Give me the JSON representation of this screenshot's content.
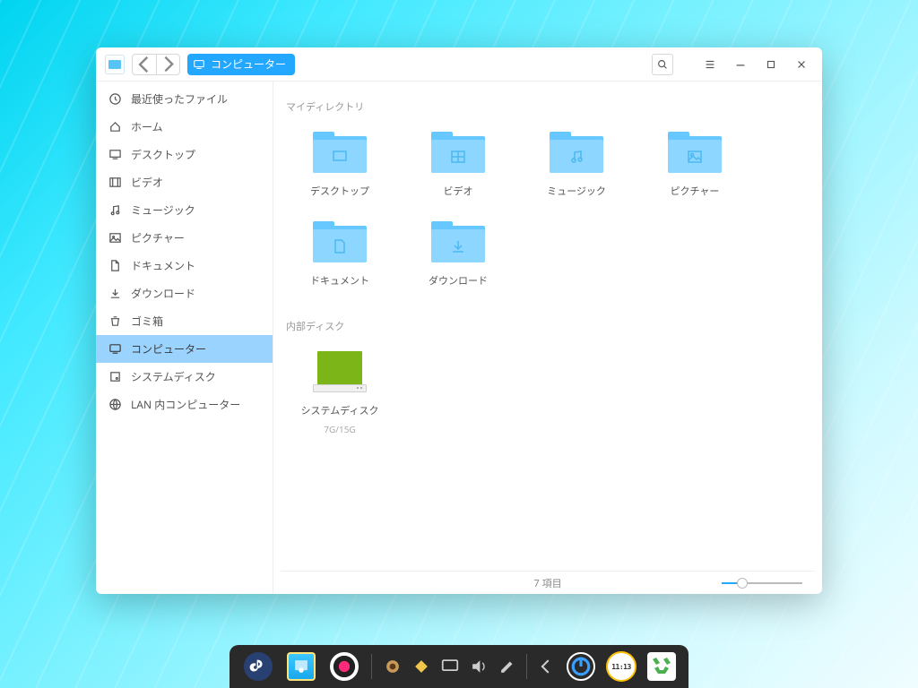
{
  "titlebar": {
    "path_label": "コンピューター"
  },
  "sidebar": {
    "items": [
      {
        "icon": "clock",
        "label": "最近使ったファイル"
      },
      {
        "icon": "home",
        "label": "ホーム"
      },
      {
        "icon": "desktop",
        "label": "デスクトップ"
      },
      {
        "icon": "video",
        "label": "ビデオ"
      },
      {
        "icon": "music",
        "label": "ミュージック"
      },
      {
        "icon": "picture",
        "label": "ピクチャー"
      },
      {
        "icon": "document",
        "label": "ドキュメント"
      },
      {
        "icon": "download",
        "label": "ダウンロード"
      },
      {
        "icon": "trash",
        "label": "ゴミ箱"
      },
      {
        "icon": "computer",
        "label": "コンピューター",
        "active": true
      },
      {
        "icon": "disk",
        "label": "システムディスク"
      },
      {
        "icon": "network",
        "label": "LAN 内コンピューター"
      }
    ]
  },
  "main": {
    "section1": "マイディレクトリ",
    "folders": [
      {
        "icon": "desktop",
        "label": "デスクトップ"
      },
      {
        "icon": "video",
        "label": "ビデオ"
      },
      {
        "icon": "music",
        "label": "ミュージック"
      },
      {
        "icon": "picture",
        "label": "ピクチャー"
      },
      {
        "icon": "document",
        "label": "ドキュメント"
      },
      {
        "icon": "download",
        "label": "ダウンロード"
      }
    ],
    "section2": "内部ディスク",
    "disks": [
      {
        "label": "システムディスク",
        "sub": "7G/15G"
      }
    ]
  },
  "statusbar": {
    "count_text": "7 項目"
  },
  "dock": {
    "clock_text": "11:13"
  }
}
